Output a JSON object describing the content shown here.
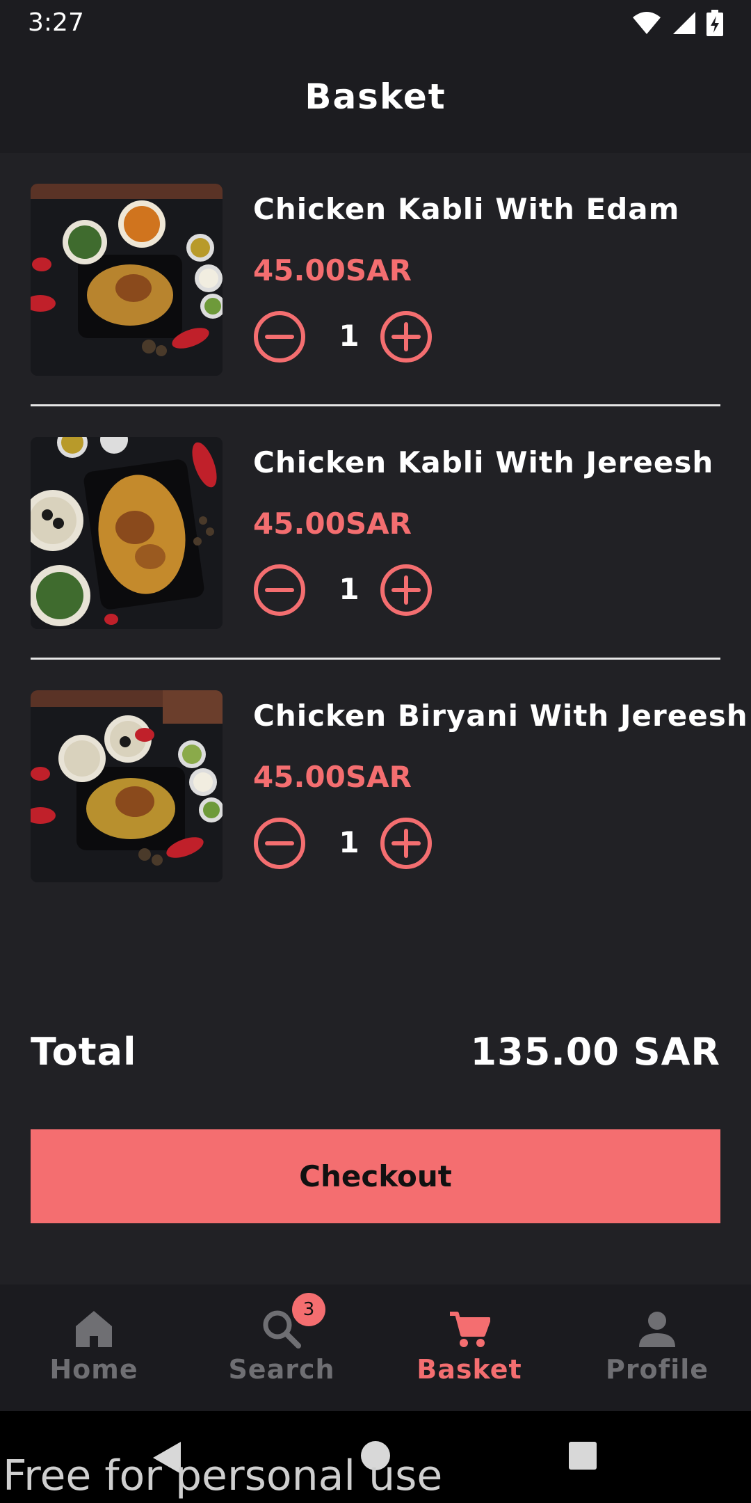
{
  "status_bar": {
    "time": "3:27"
  },
  "header": {
    "title": "Basket"
  },
  "items": [
    {
      "name": "Chicken Kabli With Edam",
      "price": "45.00SAR",
      "qty": "1"
    },
    {
      "name": "Chicken Kabli With Jereesh",
      "price": "45.00SAR",
      "qty": "1"
    },
    {
      "name": "Chicken Biryani With Jereesh",
      "price": "45.00SAR",
      "qty": "1"
    }
  ],
  "summary": {
    "total_label": "Total",
    "total_value": "135.00 SAR"
  },
  "checkout": {
    "label": "Checkout"
  },
  "bottom_nav": {
    "items": [
      {
        "label": "Home",
        "icon": "home-icon"
      },
      {
        "label": "Search",
        "icon": "search-icon"
      },
      {
        "label": "Basket",
        "icon": "cart-icon"
      },
      {
        "label": "Profile",
        "icon": "person-icon"
      }
    ],
    "active": "Basket",
    "badge": "3"
  },
  "watermark": "Free for personal use",
  "colors": {
    "accent": "#f46e70",
    "background": "#212125",
    "bar": "#1c1c20",
    "inactive": "#6f6f73"
  }
}
